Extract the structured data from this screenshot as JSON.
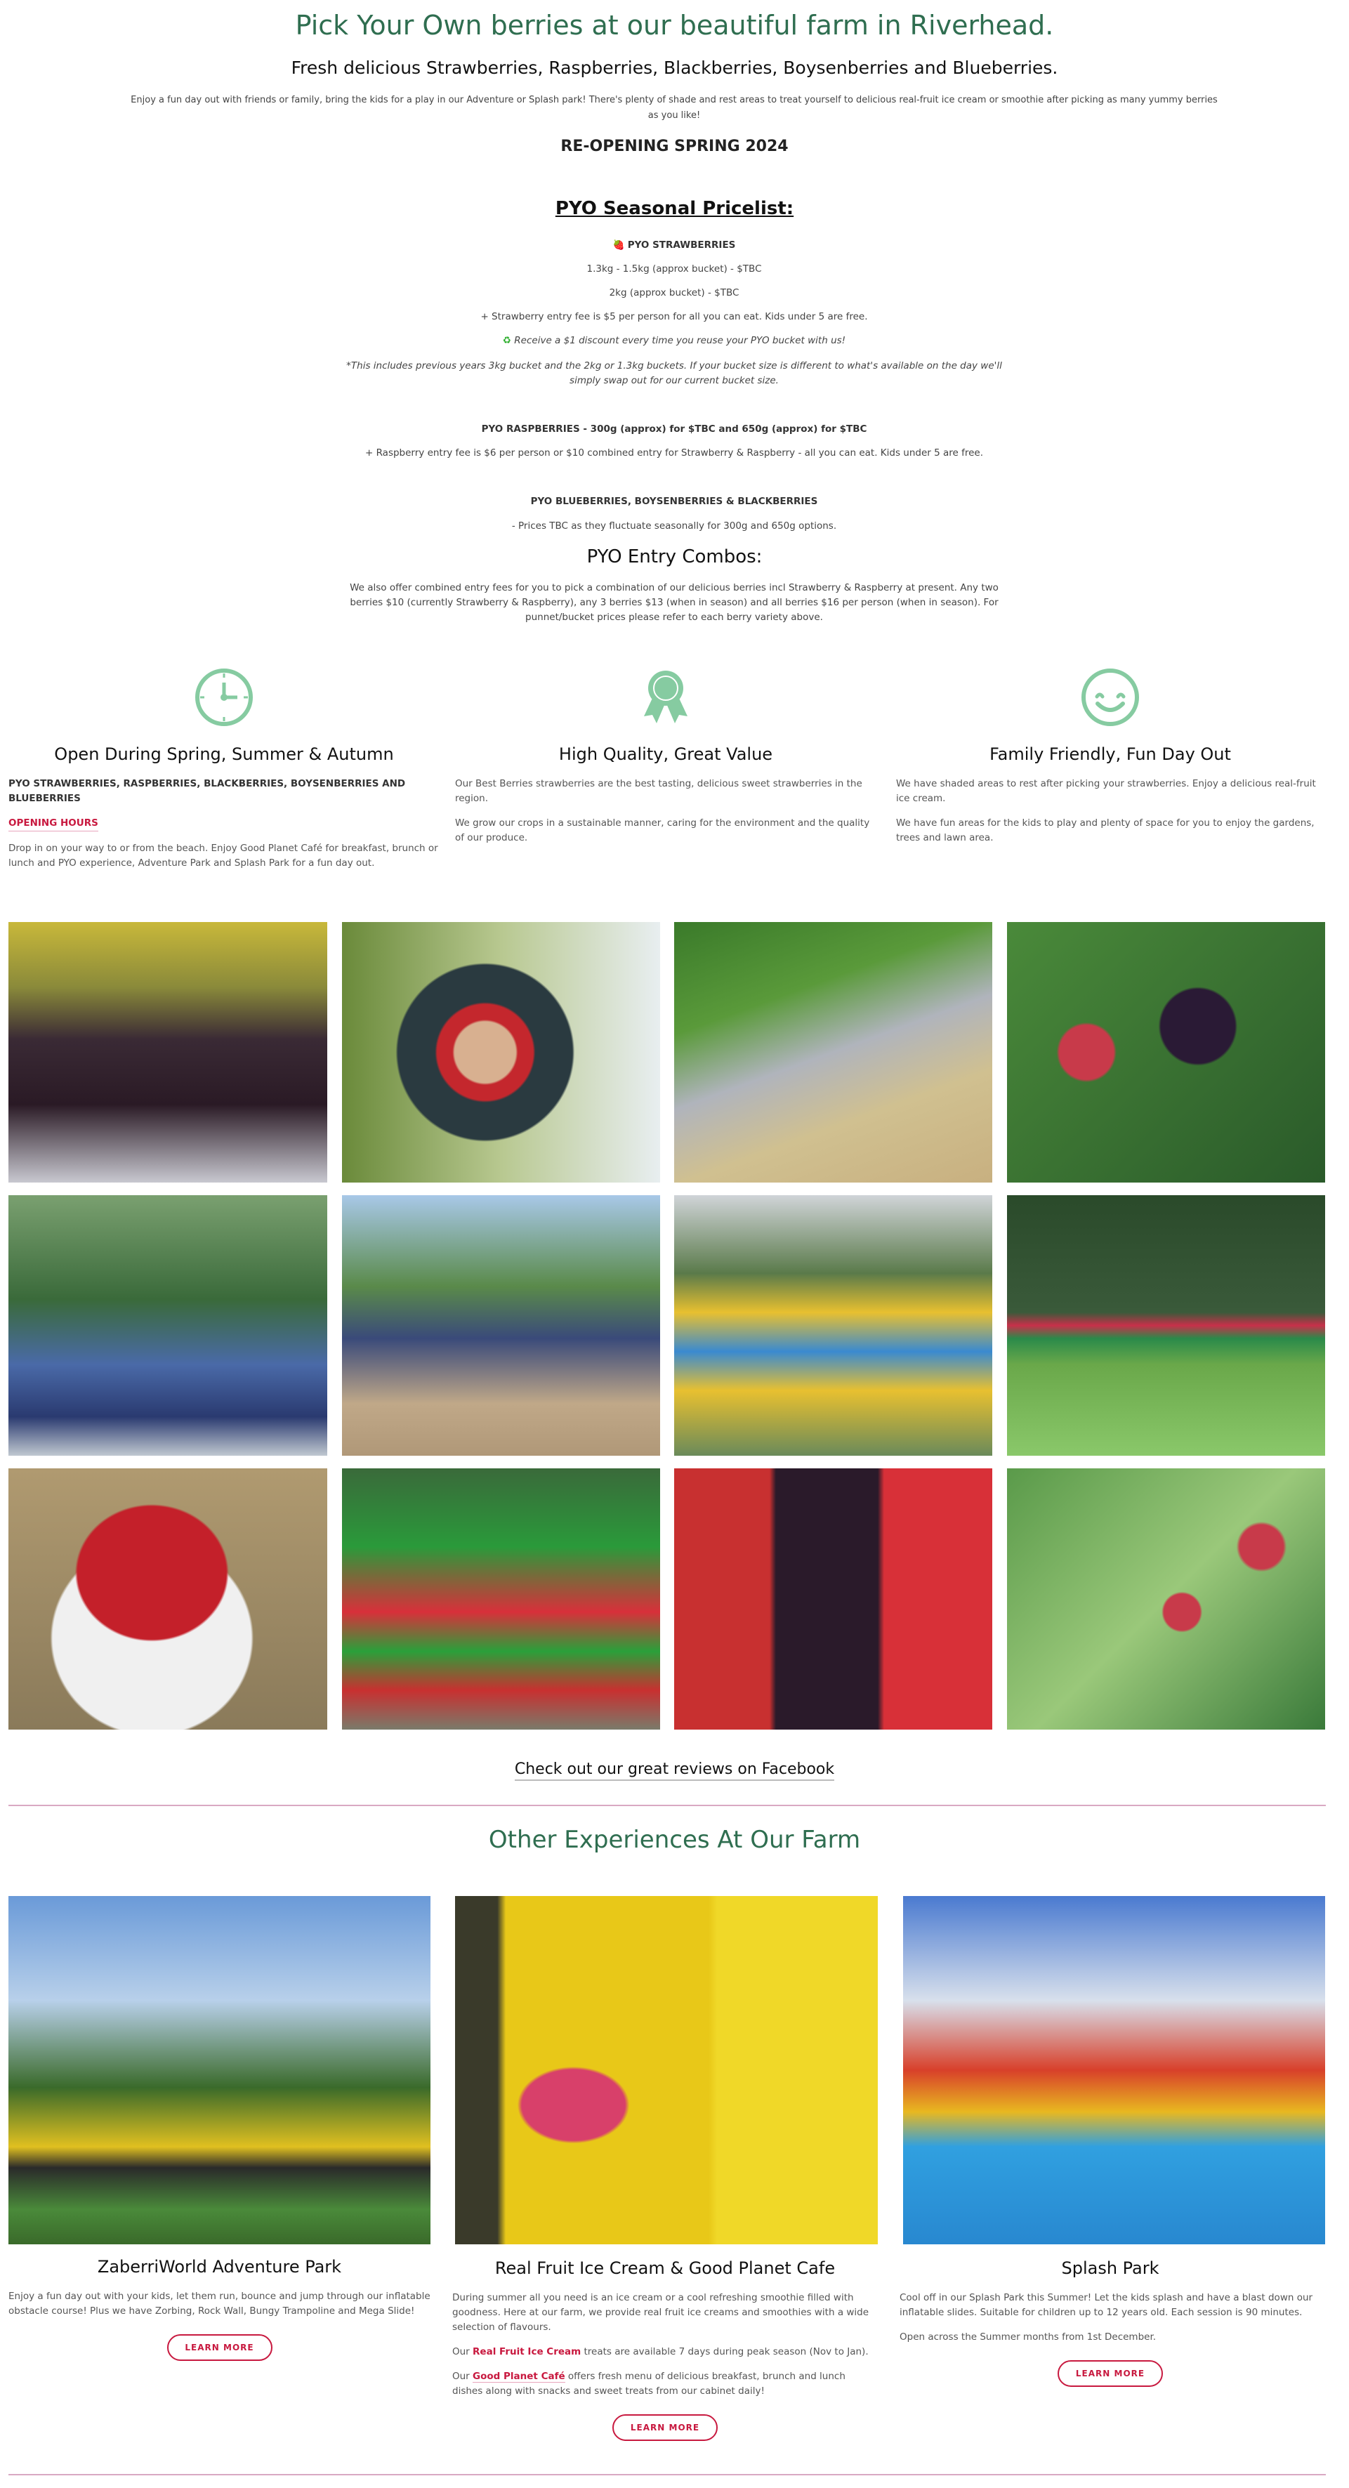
{
  "colors": {
    "brand_green": "#2f6e50",
    "icon_green": "#86cba1",
    "accent_red": "#c8193f",
    "divider": "#d9a9c3"
  },
  "hero": {
    "title": "Pick Your Own berries at our beautiful farm in Riverhead.",
    "subtitle": "Fresh delicious Strawberries, Raspberries, Blackberries, Boysenberries and Blueberries.",
    "intro": "Enjoy a fun day out with friends or family, bring the kids for a play in our Adventure or Splash park! There's plenty of shade and rest areas to treat yourself to delicious real-fruit ice cream or smoothie after picking as many yummy berries as you like!",
    "reopening": "RE-OPENING SPRING 2024"
  },
  "pricelist": {
    "title": "PYO Seasonal Pricelist:",
    "strawberries": {
      "icon": "strawberry-icon",
      "heading": "PYO STRAWBERRIES",
      "lines": [
        "1.3kg - 1.5kg (approx bucket) - $TBC",
        "2kg (approx bucket) - $TBC",
        "+ Strawberry entry fee is $5 per person for all you can eat. Kids under 5 are free."
      ],
      "discount_icon": "recycle-icon",
      "discount": "Receive a $1 discount every time you reuse your PYO bucket with us!",
      "note": "*This includes previous years 3kg bucket and the 2kg or 1.3kg buckets. If your bucket size is different to what's available on the day we'll simply swap out for our current bucket size."
    },
    "raspberries": {
      "heading": "PYO RASPBERRIES - 300g (approx) for $TBC and 650g (approx) for $TBC",
      "line": "+ Raspberry entry fee is $6 per person or $10 combined entry for Strawberry & Raspberry - all you can eat. Kids under 5 are free."
    },
    "other": {
      "heading": "PYO BLUEBERRIES, BOYSENBERRIES & BLACKBERRIES",
      "line": "- Prices TBC as they fluctuate seasonally for 300g and 650g options."
    }
  },
  "combos": {
    "title": "PYO Entry Combos:",
    "text": "We also offer combined entry fees for you to pick a combination of our delicious berries incl Strawberry & Raspberry at present. Any two berries $10 (currently Strawberry & Raspberry), any 3 berries $13 (when in season) and all berries $16 per person (when in season). For punnet/bucket prices please refer to each berry variety above."
  },
  "features": [
    {
      "icon": "clock-icon",
      "title": "Open During Spring, Summer & Autumn",
      "caps": "PYO STRAWBERRIES,  RASPBERRIES,  BLACKBERRIES, BOYSENBERRIES AND BLUEBERRIES",
      "link": "OPENING HOURS",
      "paragraphs": [
        "Drop in on your way to or from the beach. Enjoy Good Planet Café for breakfast, brunch or lunch and PYO experience, Adventure Park and Splash Park for a fun day out."
      ]
    },
    {
      "icon": "award-ribbon-icon",
      "title": "High Quality, Great Value",
      "paragraphs": [
        "Our Best Berries strawberries are the best tasting, delicious sweet strawberries in the region.",
        "We grow our crops in a sustainable manner, caring for the environment and the quality of our produce."
      ]
    },
    {
      "icon": "smiley-face-icon",
      "title": "Family Friendly, Fun Day Out",
      "paragraphs": [
        "We have shaded areas to rest after picking your strawberries. Enjoy a delicious real-fruit ice cream.",
        "We have fun areas for the kids to play and plenty of space for you to enjoy the gardens, trees and lawn area."
      ]
    }
  ],
  "reviews_link": "Check out our great reviews on Facebook",
  "other": {
    "title": "Other Experiences At Our Farm",
    "items": [
      {
        "title": "ZaberriWorld Adventure Park",
        "paragraphs": [
          "Enjoy a fun day out with your kids, let them run, bounce and jump through our inflatable obstacle course! Plus we have Zorbing, Rock Wall, Bungy Trampoline and Mega Slide!"
        ],
        "button": "LEARN MORE"
      },
      {
        "title": "Real Fruit Ice Cream & Good Planet Cafe",
        "p1": "During summer all you need is an ice cream or a cool refreshing smoothie filled with goodness. Here at our farm, we provide real fruit ice creams and smoothies with a wide selection of flavours.",
        "p2_pre": "Our ",
        "p2_link": "Real Fruit Ice Cream",
        "p2_post": " treats are available 7 days during peak season (Nov to Jan).",
        "p3_pre": "Our ",
        "p3_link": "Good Planet Café",
        "p3_post": "  offers fresh menu of delicious breakfast, brunch and lunch dishes along with snacks and sweet treats from our cabinet daily!",
        "button": "LEARN MORE"
      },
      {
        "title": "Splash Park",
        "paragraphs": [
          "Cool off in our Splash Park this Summer! Let the kids splash and have a blast down our inflatable slides. Suitable for children up to 12 years old. Each session is 90 minutes.",
          "Open across the Summer months from 1st December."
        ],
        "button": "LEARN MORE"
      }
    ]
  }
}
